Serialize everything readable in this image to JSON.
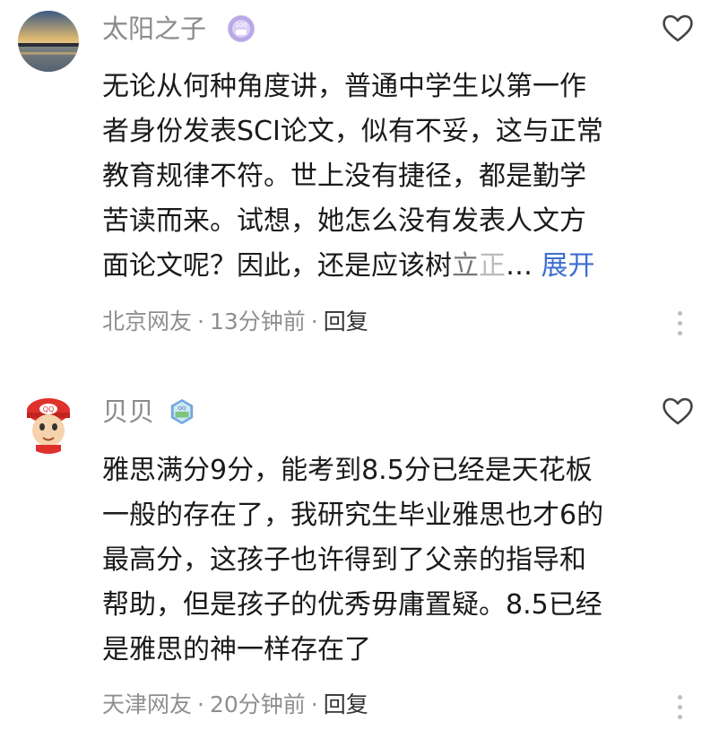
{
  "comments": [
    {
      "username": "太阳之子",
      "badge": {
        "text": "100",
        "icon": "level-badge-icon",
        "color": "#b9a7e6"
      },
      "avatar_icon": "sunset-lake-avatar",
      "lines": [
        "无论从何种角度讲，普通中学生以第一作",
        "者身份发表SCI论文，似有不妥，这与正常",
        "教育规律不符。世上没有捷径，都是勤学",
        "苦读而来。试想，她怎么没有发表人文方"
      ],
      "last_line": {
        "main": "面论文呢？因此，还是应该树",
        "fade1": "立",
        "fade2": "正",
        "ellipsis": "…",
        "expand": "展开"
      },
      "location": "北京网友",
      "time": "13分钟前",
      "reply": "回复"
    },
    {
      "username": "贝贝",
      "badge": {
        "text": "QQ",
        "icon": "verified-badge-icon",
        "color": "#6fa8dc"
      },
      "avatar_icon": "cartoon-boy-avatar",
      "lines": [
        "雅思满分9分，能考到8.5分已经是天花板",
        "一般的存在了，我研究生毕业雅思也才6的",
        "最高分，这孩子也许得到了父亲的指导和",
        "帮助，但是孩子的优秀毋庸置疑。8.5已经",
        "是雅思的神一样存在了"
      ],
      "location": "天津网友",
      "time": "20分钟前",
      "reply": "回复"
    }
  ],
  "colors": {
    "expand": "#3d6ecf",
    "meta": "#8f8f8f",
    "username": "#8a8a8a"
  }
}
